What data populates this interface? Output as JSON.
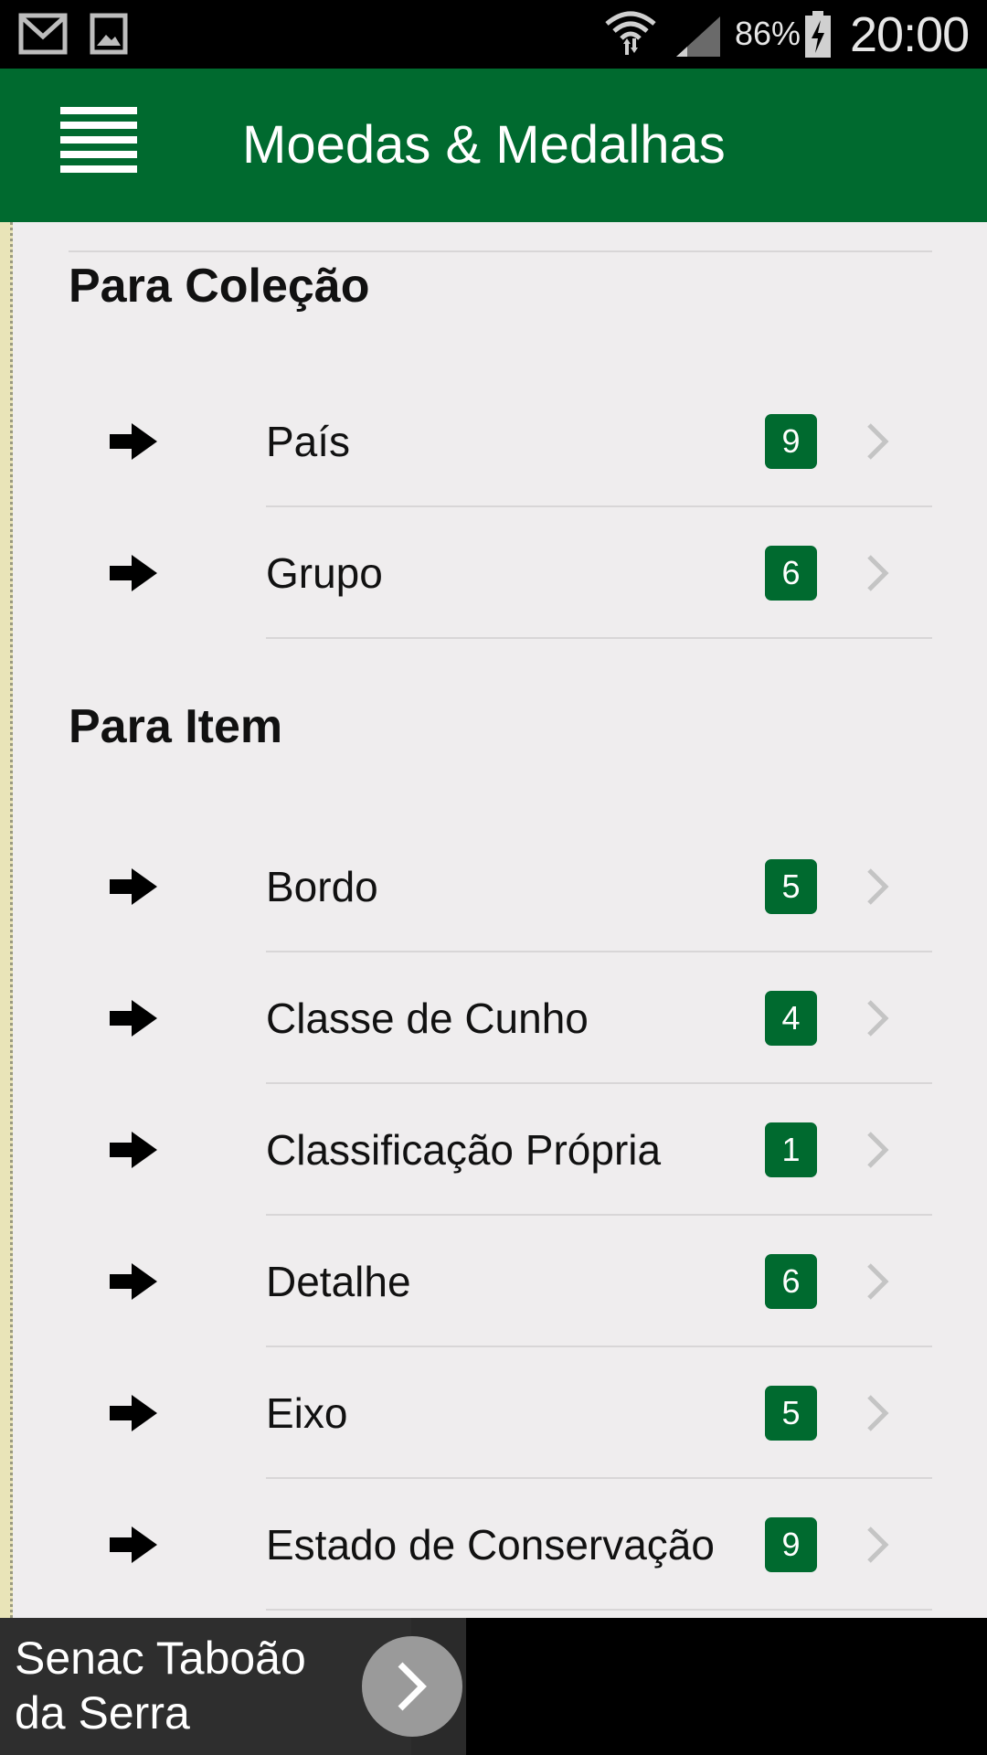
{
  "status_bar": {
    "battery_percent": "86%",
    "time": "20:00",
    "icons": [
      "gmail-icon",
      "gallery-icon",
      "wifi-icon",
      "signal-icon",
      "battery-charging-icon"
    ]
  },
  "app_bar": {
    "title": "Moedas & Medalhas",
    "menu_icon": "hamburger-menu-icon",
    "color": "#006a2f"
  },
  "sections": [
    {
      "header": "Para Coleção",
      "items": [
        {
          "label": "País",
          "count": "9"
        },
        {
          "label": "Grupo",
          "count": "6"
        }
      ]
    },
    {
      "header": "Para Item",
      "items": [
        {
          "label": "Bordo",
          "count": "5"
        },
        {
          "label": "Classe de Cunho",
          "count": "4"
        },
        {
          "label": "Classificação Própria",
          "count": "1"
        },
        {
          "label": "Detalhe",
          "count": "6"
        },
        {
          "label": "Eixo",
          "count": "5"
        },
        {
          "label": "Estado de Conservação",
          "count": "9"
        }
      ]
    }
  ],
  "ad": {
    "text": "Senac Taboão da Serra"
  }
}
